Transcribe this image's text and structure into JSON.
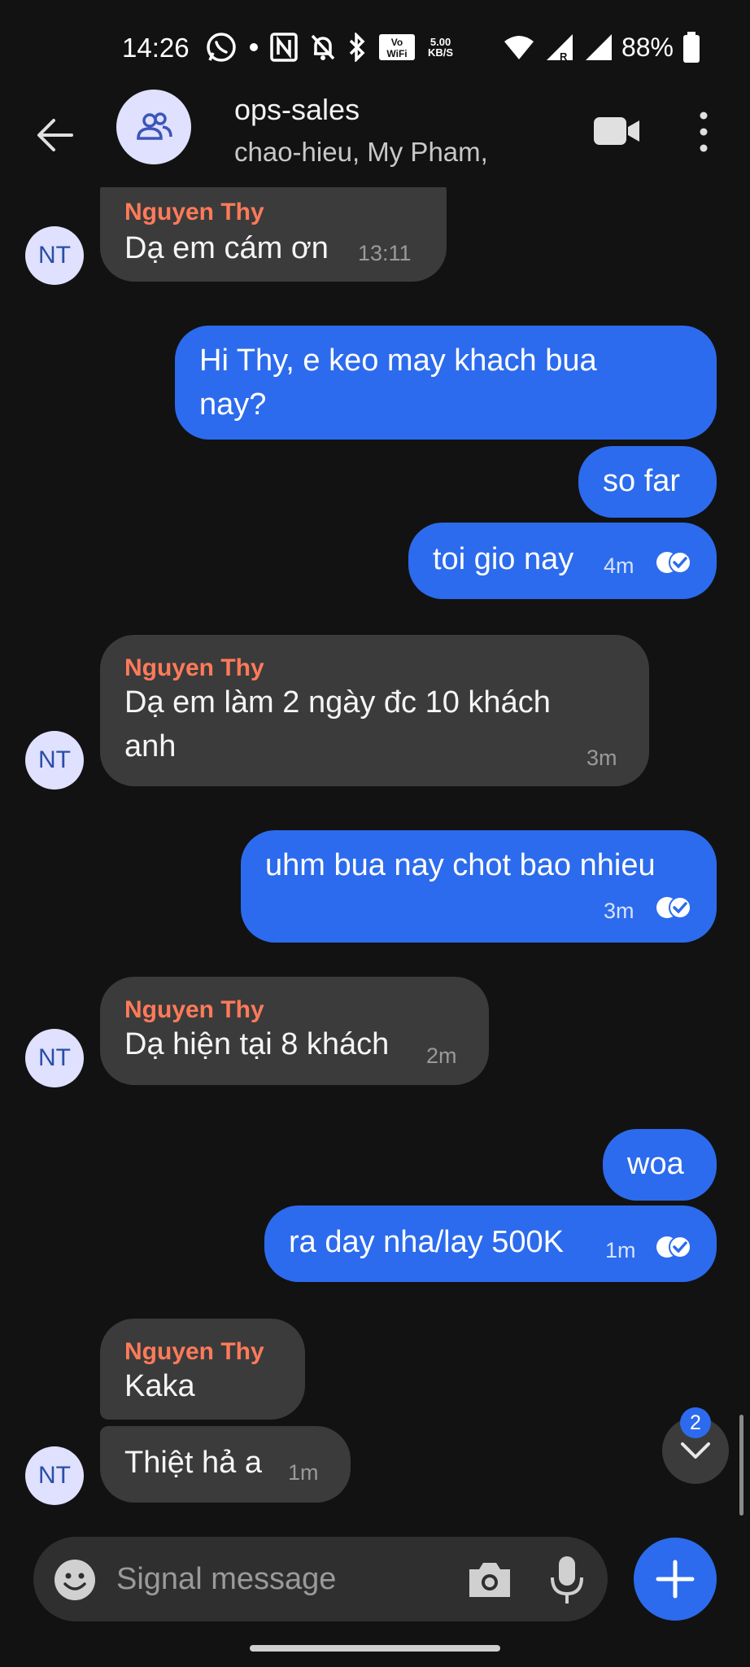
{
  "status_bar": {
    "time": "14:26",
    "net_speed_value": "5.00",
    "net_speed_unit": "KB/S",
    "battery": "88%",
    "icons": [
      "whatsapp-icon",
      "dot-icon",
      "nfc-icon",
      "bell-off-icon",
      "bluetooth-icon",
      "vowifi-icon",
      "wifi-icon",
      "signal-icon",
      "battery-icon"
    ]
  },
  "header": {
    "title": "ops-sales",
    "subtitle": "chao-hieu, My Pham,"
  },
  "messages": [
    {
      "direction": "in",
      "sender": "Nguyen Thy",
      "text": "Dạ em cám ơn",
      "time": "13:11",
      "avatar": "NT"
    },
    {
      "direction": "out",
      "lines": [
        "Hi Thy, e keo may khach bua",
        "nay?"
      ]
    },
    {
      "direction": "out",
      "text": "so far"
    },
    {
      "direction": "out",
      "text": "toi gio nay",
      "time": "4m",
      "receipt": "read"
    },
    {
      "direction": "in",
      "sender": "Nguyen Thy",
      "lines": [
        "Dạ em làm 2 ngày đc 10 khách",
        "anh"
      ],
      "time": "3m",
      "avatar": "NT"
    },
    {
      "direction": "out",
      "text": "uhm bua nay chot bao nhieu",
      "time": "3m",
      "receipt": "read"
    },
    {
      "direction": "in",
      "sender": "Nguyen Thy",
      "text": "Dạ hiện tại 8 khách",
      "time": "2m",
      "avatar": "NT"
    },
    {
      "direction": "out",
      "text": "woa"
    },
    {
      "direction": "out",
      "text": "ra day nha/lay 500K",
      "time": "1m",
      "receipt": "read"
    },
    {
      "direction": "in",
      "sender": "Nguyen Thy",
      "text": "Kaka"
    },
    {
      "direction": "in",
      "text": "Thiệt hả a",
      "time": "1m",
      "avatar": "NT"
    }
  ],
  "scroll": {
    "unread_count": "2"
  },
  "composer": {
    "placeholder": "Signal message"
  },
  "colors": {
    "outgoing": "#2c6bed",
    "incoming": "#3b3b3b",
    "sender_name": "#ff7a59",
    "background": "#121212"
  }
}
